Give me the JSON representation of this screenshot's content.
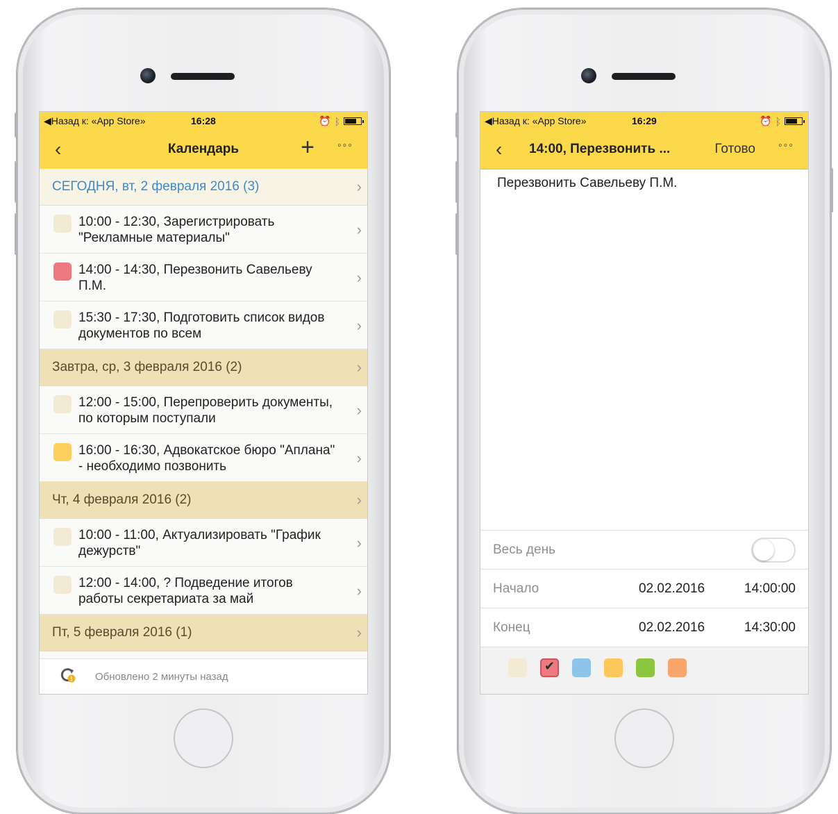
{
  "left_phone": {
    "status": {
      "back_app": "◀Назад к: «App Store»",
      "time": "16:28"
    },
    "nav": {
      "back": "‹",
      "title": "Календарь",
      "add": "+",
      "more": "◦◦◦"
    },
    "days": [
      {
        "header": "СЕГОДНЯ, вт, 2 февраля 2016 (3)",
        "events": [
          {
            "text": "10:00 - 12:30, Зарегистрировать \"Рекламные материалы\"",
            "color": "#f3ead3"
          },
          {
            "text": "14:00 - 14:30, Перезвонить Савельеву П.М.",
            "color": "#ec7a80"
          },
          {
            "text": "15:30 - 17:30, Подготовить список видов документов по всем",
            "color": "#f3ead3"
          }
        ]
      },
      {
        "header": "Завтра, ср, 3 февраля 2016 (2)",
        "events": [
          {
            "text": "12:00 - 15:00, Перепроверить документы, по которым поступали",
            "color": "#f3ead3"
          },
          {
            "text": "16:00 - 16:30, Адвокатское бюро \"Аплана\" - необходимо позвонить",
            "color": "#fdd05e"
          }
        ]
      },
      {
        "header": "Чт, 4 февраля 2016 (2)",
        "events": [
          {
            "text": "10:00 - 11:00, Актуализировать \"График дежурств\"",
            "color": "#f3ead3"
          },
          {
            "text": "12:00 - 14:00, ? Подведение итогов работы секретариата за май",
            "color": "#f3ead3"
          }
        ]
      },
      {
        "header": "Пт, 5 февраля 2016 (1)",
        "events": []
      }
    ],
    "footer": {
      "updated": "Обновлено 2 минуты назад"
    }
  },
  "right_phone": {
    "status": {
      "back_app": "◀Назад к: «App Store»",
      "time": "16:29"
    },
    "nav": {
      "back": "‹",
      "title": "14:00, Перезвонить ...",
      "done": "Готово",
      "more": "◦◦◦"
    },
    "note": "Перезвонить Савельеву П.М.",
    "form": {
      "all_day_label": "Весь день",
      "all_day_on": false,
      "start_label": "Начало",
      "start_date": "02.02.2016",
      "start_time": "14:00:00",
      "end_label": "Конец",
      "end_date": "02.02.2016",
      "end_time": "14:30:00"
    },
    "palette": [
      {
        "color": "#f3ead3",
        "selected": false
      },
      {
        "color": "#ec7a80",
        "selected": true
      },
      {
        "color": "#8ec3ea",
        "selected": false
      },
      {
        "color": "#fdc85a",
        "selected": false
      },
      {
        "color": "#8cc63f",
        "selected": false
      },
      {
        "color": "#f8a66e",
        "selected": false
      }
    ]
  }
}
